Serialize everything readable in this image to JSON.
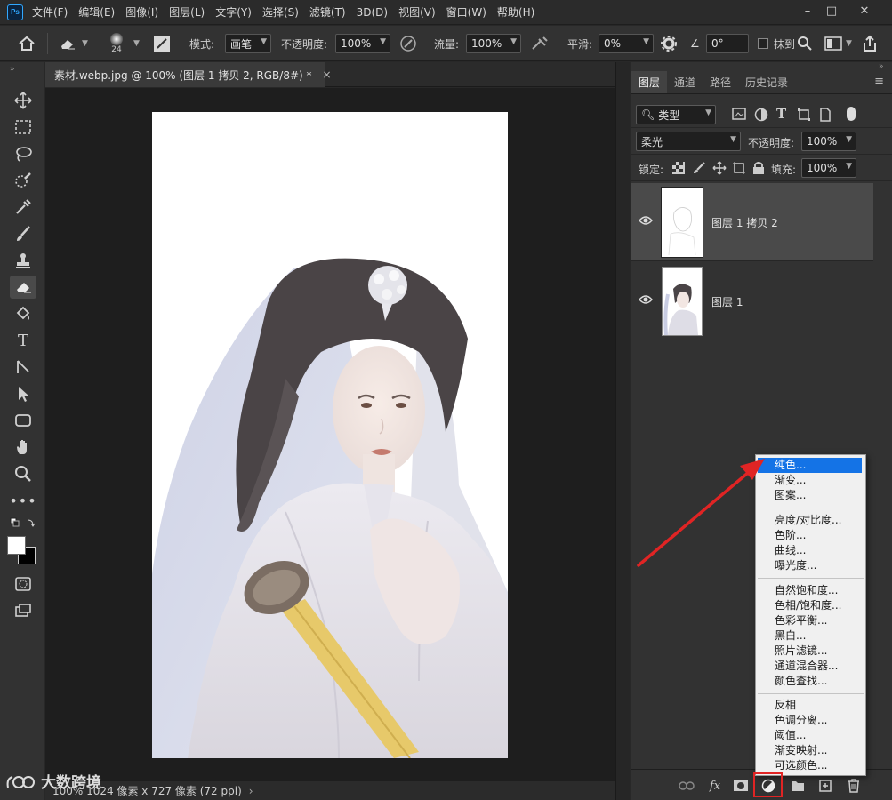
{
  "menubar": {
    "logo": "Ps",
    "items": [
      "文件(F)",
      "编辑(E)",
      "图像(I)",
      "图层(L)",
      "文字(Y)",
      "选择(S)",
      "滤镜(T)",
      "3D(D)",
      "视图(V)",
      "窗口(W)",
      "帮助(H)"
    ],
    "window_controls": [
      "–",
      "□",
      "✕"
    ]
  },
  "options": {
    "brush_size": "24",
    "mode_label": "模式:",
    "mode_value": "画笔",
    "opacity_label": "不透明度:",
    "opacity_value": "100%",
    "flow_label": "流量:",
    "flow_value": "100%",
    "smooth_label": "平滑:",
    "smooth_value": "0%",
    "angle_value": "0°",
    "erase_history_label": "抹到"
  },
  "document": {
    "tab_title": "素材.webp.jpg @ 100% (图层 1 拷贝 2, RGB/8#) *",
    "close": "×",
    "status": "100%     1024 像素 x 727 像素 (72 ppi)"
  },
  "watermark": "大数跨境",
  "layers_panel": {
    "tabs": [
      "图层",
      "通道",
      "路径",
      "历史记录"
    ],
    "active_tab": "图层",
    "filter_label": "类型",
    "blend_mode": "柔光",
    "opacity_label": "不透明度:",
    "opacity_value": "100%",
    "lock_label": "锁定:",
    "fill_label": "填充:",
    "fill_value": "100%",
    "layers": [
      {
        "name": "图层 1 拷贝 2",
        "selected": true
      },
      {
        "name": "图层 1",
        "selected": false
      }
    ],
    "bottom_fx": "fx"
  },
  "adjustment_menu": {
    "groups": [
      [
        "纯色...",
        "渐变...",
        "图案..."
      ],
      [
        "亮度/对比度...",
        "色阶...",
        "曲线...",
        "曝光度..."
      ],
      [
        "自然饱和度...",
        "色相/饱和度...",
        "色彩平衡...",
        "黑白...",
        "照片滤镜...",
        "通道混合器...",
        "颜色查找..."
      ],
      [
        "反相",
        "色调分离...",
        "阈值...",
        "渐变映射...",
        "可选颜色..."
      ]
    ],
    "highlighted": "纯色..."
  },
  "colors": {
    "accent": "#1473e6",
    "annotation_red": "#e02424",
    "ps_blue": "#31a8ff"
  }
}
